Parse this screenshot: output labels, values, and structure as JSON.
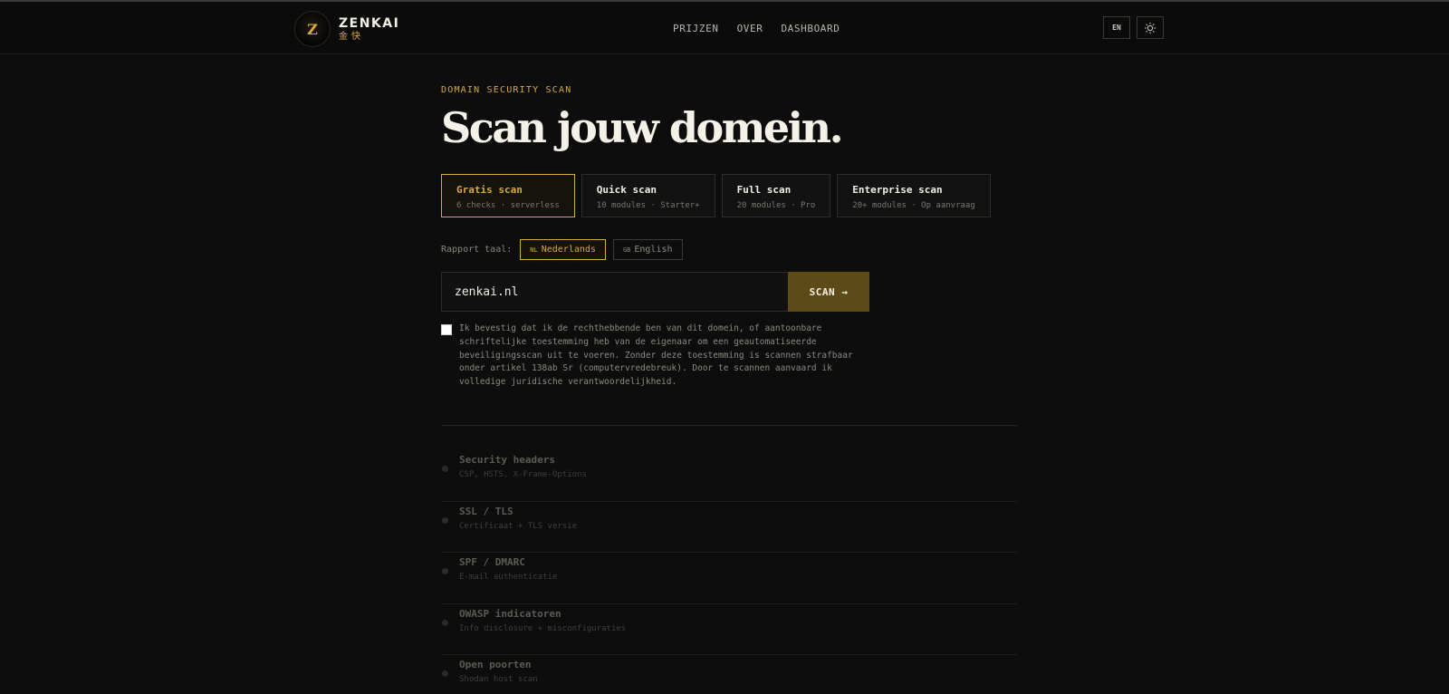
{
  "header": {
    "logo_mark": "Z",
    "logo_name": "ZENKAI",
    "logo_sub": "金快",
    "nav": [
      "PRIJZEN",
      "OVER",
      "DASHBOARD"
    ],
    "lang_button": "EN",
    "theme_icon": "sun-icon"
  },
  "hero": {
    "eyebrow": "DOMAIN SECURITY SCAN",
    "title": "Scan jouw domein."
  },
  "tiers": [
    {
      "name": "Gratis scan",
      "desc": "6 checks · serverless",
      "active": true
    },
    {
      "name": "Quick scan",
      "desc": "10 modules · Starter+",
      "active": false
    },
    {
      "name": "Full scan",
      "desc": "20 modules · Pro",
      "active": false
    },
    {
      "name": "Enterprise scan",
      "desc": "20+ modules · Op aanvraag",
      "active": false
    }
  ],
  "report_language": {
    "label": "Rapport taal:",
    "options": [
      {
        "flag": "NL",
        "label": "Nederlands",
        "active": true
      },
      {
        "flag": "GB",
        "label": "English",
        "active": false
      }
    ]
  },
  "scan_form": {
    "domain_value": "zenkai.nl",
    "button": "SCAN →"
  },
  "consent": {
    "checked": false,
    "text": "Ik bevestig dat ik de rechthebbende ben van dit domein, of aantoonbare schriftelijke toestemming heb van de eigenaar om een geautomatiseerde beveiligingsscan uit te voeren. Zonder deze toestemming is scannen strafbaar onder artikel 138ab Sr (computervredebreuk). Door te scannen aanvaard ik volledige juridische verantwoordelijkheid."
  },
  "checks": [
    {
      "name": "Security headers",
      "desc": "CSP, HSTS, X-Frame-Options"
    },
    {
      "name": "SSL / TLS",
      "desc": "Certificaat + TLS versie"
    },
    {
      "name": "SPF / DMARC",
      "desc": "E-mail authenticatie"
    },
    {
      "name": "OWASP indicatoren",
      "desc": "Info disclosure + misconfiguraties"
    },
    {
      "name": "Open poorten",
      "desc": "Shodan host scan"
    }
  ],
  "colors": {
    "accent": "#d8aa38",
    "background": "#0d0d0d",
    "scan_button": "#5e4a16"
  }
}
